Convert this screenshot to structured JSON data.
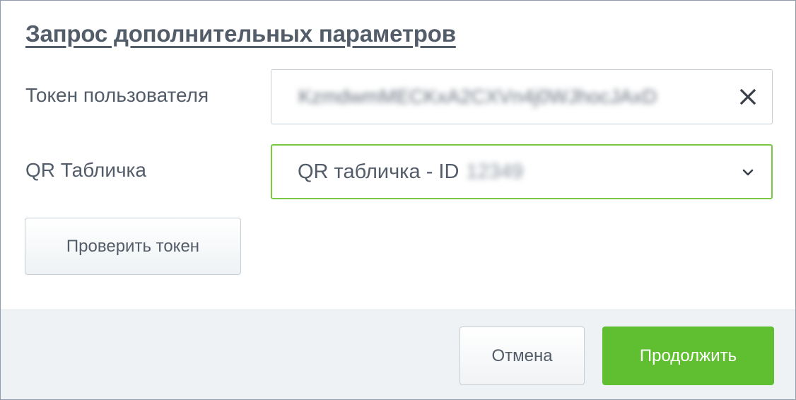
{
  "dialog": {
    "title": "Запрос дополнительных параметров"
  },
  "form": {
    "token_label": "Токен пользователя",
    "token_value": "KzmdwmMECKxA2CXVn4j0WJhocJAxD",
    "qr_label": "QR Табличка",
    "qr_selected": "QR табличка - ID",
    "qr_selected_id": "12349"
  },
  "icons": {
    "clear": "close-icon",
    "dropdown": "chevron-down-icon"
  },
  "buttons": {
    "check_token": "Проверить токен",
    "cancel": "Отмена",
    "continue": "Продолжить"
  },
  "colors": {
    "accent_green": "#5fbf31",
    "focus_border": "#7ac943",
    "text": "#535c69",
    "footer_bg": "#eef2f4"
  }
}
